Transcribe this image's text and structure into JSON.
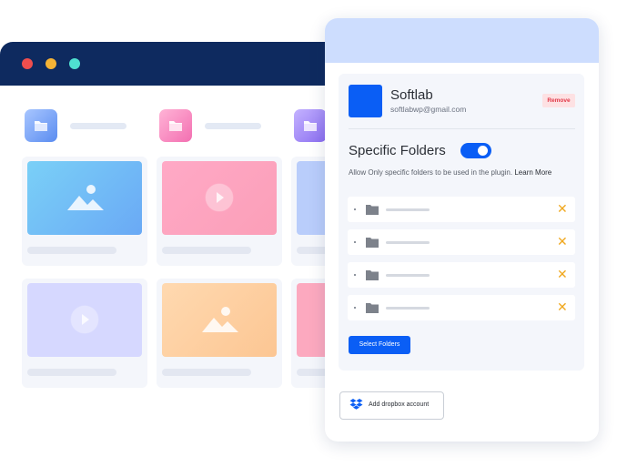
{
  "browser": {
    "window_dots": [
      "red",
      "yellow",
      "green"
    ]
  },
  "colors": {
    "titlebar": "#0e2a5f",
    "accent": "#0a5ef5",
    "panel_header": "#cdddfe",
    "remove_bg": "#fde1e3",
    "remove_text": "#e23a4a",
    "close_x": "#f0a81f"
  },
  "gallery": {
    "folders": [
      {
        "icon": "folder-icon",
        "color": "blue"
      },
      {
        "icon": "folder-icon",
        "color": "pink"
      },
      {
        "icon": "folder-icon",
        "color": "purple"
      }
    ],
    "cards": [
      {
        "thumb": "image-icon",
        "color": "#78c6f7"
      },
      {
        "thumb": "play-icon",
        "color": "#fda9c4"
      },
      {
        "thumb": "",
        "color": "#b9cdfb"
      },
      {
        "thumb": "play-icon",
        "color": "#d6d8ff"
      },
      {
        "thumb": "image-icon",
        "color": "#fdd0a6"
      },
      {
        "thumb": "",
        "color": "#fca9bf"
      }
    ]
  },
  "account": {
    "name": "Softlab",
    "email": "softlabwp@gmail.com",
    "remove_label": "Remove"
  },
  "specific_folders": {
    "title": "Specific Folders",
    "enabled": true,
    "description": "Allow Only specific folders to be used in the plugin.",
    "learn_more": "Learn More",
    "rows": [
      {
        "icon": "folder-icon",
        "remove_icon": "close-icon"
      },
      {
        "icon": "folder-icon",
        "remove_icon": "close-icon"
      },
      {
        "icon": "folder-icon",
        "remove_icon": "close-icon"
      },
      {
        "icon": "folder-icon",
        "remove_icon": "close-icon"
      }
    ],
    "select_button": "Select Folders"
  },
  "dropbox": {
    "button_label": "Add dropbox account",
    "icon": "dropbox-icon"
  },
  "glyphs": {
    "close": "✕"
  }
}
